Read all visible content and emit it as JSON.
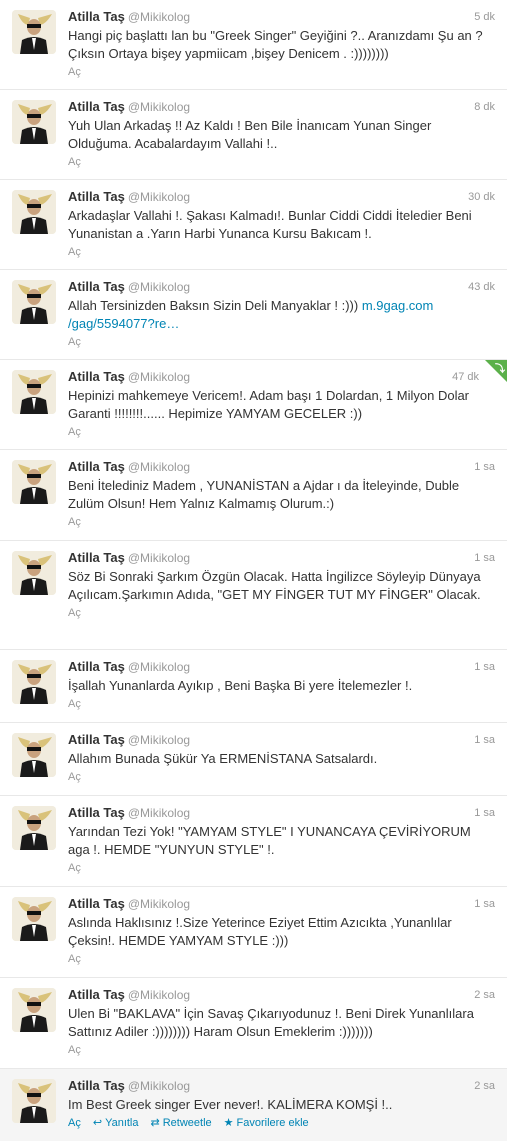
{
  "author": {
    "name": "Atilla Taş",
    "handle": "@Mikikolog"
  },
  "labels": {
    "expand": "Aç",
    "reply": "Yanıtla",
    "retweet": "Retweetle",
    "favorite": "Favorilere ekle"
  },
  "colors": {
    "link": "#0084b4",
    "retweet_corner": "#5bb04a"
  },
  "tweets": [
    {
      "time": "5 dk",
      "text": "Hangi piç başlattı lan bu \"Greek Singer\" Geyiğini ?.. Aranızdamı Şu an ?Çıksın Ortaya bişey yapmiicam ,bişey Denicem . :))))))))"
    },
    {
      "time": "8 dk",
      "text": "Yuh Ulan Arkadaş !! Az Kaldı ! Ben Bile İnanıcam Yunan Singer Olduğuma. Acabalardayım Vallahi !.."
    },
    {
      "time": "30 dk",
      "text": "Arkadaşlar Vallahi !. Şakası Kalmadı!. Bunlar Ciddi Ciddi İteledier Beni Yunanistan a .Yarın Harbi Yunanca Kursu Bakıcam !."
    },
    {
      "time": "43 dk",
      "text": "Allah Tersinizden Baksın Sizin Deli Manyaklar ! :)))",
      "link": "m.9gag.com /gag/5594077?re…"
    },
    {
      "time": "47 dk",
      "text": "Hepinizi mahkemeye Vericem!. Adam başı 1 Dolardan, 1 Milyon Dolar Garanti !!!!!!!!...... Hepimize YAMYAM GECELER :))"
    },
    {
      "time": "1 sa",
      "text": "Beni İtelediniz Madem , YUNANİSTAN a Ajdar ı da İteleyinde, Duble Zulüm Olsun! Hem Yalnız Kalmamış Olurum.:)"
    },
    {
      "time": "1 sa",
      "text": "Söz Bi Sonraki Şarkım Özgün Olacak. Hatta İngilizce Söyleyip Dünyaya Açılıcam.Şarkımın Adıda, \"GET MY FİNGER TUT MY FİNGER\" Olacak."
    },
    {
      "time": "1 sa",
      "text": "İşallah Yunanlarda Ayıkıp , Beni Başka Bi yere İtelemezler !."
    },
    {
      "time": "1 sa",
      "text": "Allahım Bunada Şükür Ya ERMENİSTANA Satsalardı."
    },
    {
      "time": "1 sa",
      "text": "Yarından Tezi Yok! \"YAMYAM STYLE\" I YUNANCAYA ÇEVİRİYORUM aga !. HEMDE \"YUNYUN STYLE\" !."
    },
    {
      "time": "1 sa",
      "text": "Aslında Haklısınız !.Size Yeterince Eziyet Ettim Azıcıkta ,Yunanlılar Çeksin!. HEMDE YAMYAM STYLE :)))"
    },
    {
      "time": "2 sa",
      "text": "Ulen Bi \"BAKLAVA\" İçin Savaş Çıkarıyodunuz !. Beni Direk Yunanlılara Sattınız Adiler :)))))))) Haram Olsun Emeklerim :)))))))"
    },
    {
      "time": "2 sa",
      "text": "Im Best Greek singer Ever never!. KALİMERA KOMŞİ !.."
    }
  ]
}
